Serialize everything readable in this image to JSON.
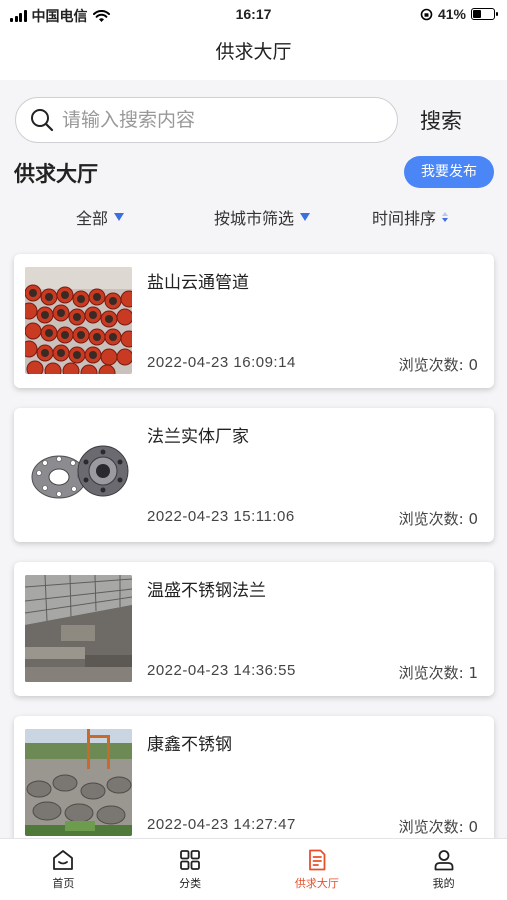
{
  "status_bar": {
    "carrier": "中国电信",
    "time": "16:17",
    "battery_percent": "41%",
    "battery_level": 0.41
  },
  "header": {
    "title": "供求大厅"
  },
  "search": {
    "placeholder": "请输入搜索内容",
    "value": "",
    "button_label": "搜索"
  },
  "section": {
    "title": "供求大厅",
    "publish_label": "我要发布"
  },
  "filters": {
    "all": "全部",
    "city": "按城市筛选",
    "sort": "时间排序"
  },
  "colors": {
    "accent": "#4a86f5",
    "active_tab": "#e8502a",
    "filter_arrow": "#3b6fe0"
  },
  "listings": [
    {
      "title": "盐山云通管道",
      "date": "2022-04-23 16:09:14",
      "views": "浏览次数: 0",
      "image": "red-steel-pipes"
    },
    {
      "title": "法兰实体厂家",
      "date": "2022-04-23 15:11:06",
      "views": "浏览次数: 0",
      "image": "steel-flanges"
    },
    {
      "title": "温盛不锈钢法兰",
      "date": "2022-04-23 14:36:55",
      "views": "浏览次数: 1",
      "image": "factory-warehouse"
    },
    {
      "title": "康鑫不锈钢",
      "date": "2022-04-23 14:27:47",
      "views": "浏览次数: 0",
      "image": "pipe-yard"
    }
  ],
  "tabs": [
    {
      "label": "首页",
      "icon": "home-icon",
      "active": false
    },
    {
      "label": "分类",
      "icon": "grid-icon",
      "active": false
    },
    {
      "label": "供求大厅",
      "icon": "document-icon",
      "active": true
    },
    {
      "label": "我的",
      "icon": "user-icon",
      "active": false
    }
  ]
}
